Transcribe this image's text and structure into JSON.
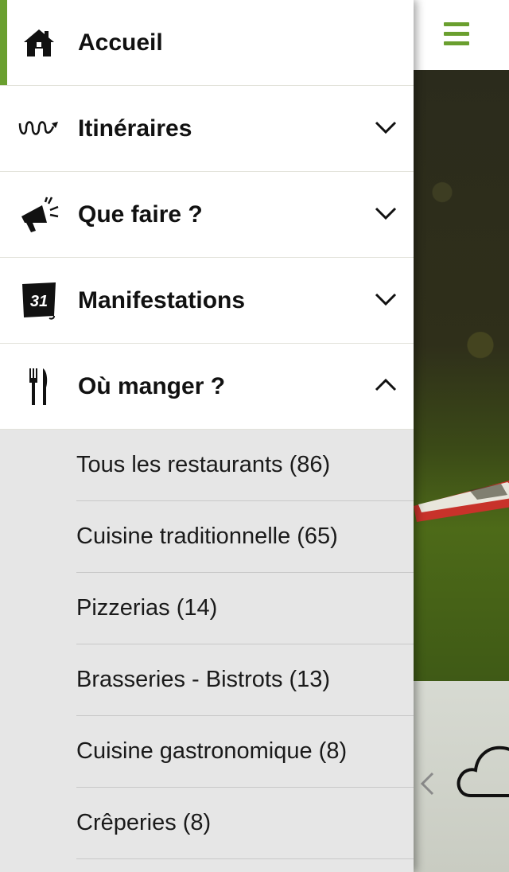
{
  "menu": {
    "items": [
      {
        "label": "Accueil",
        "icon": "home-icon",
        "active": true
      },
      {
        "label": "Itinéraires",
        "icon": "route-icon",
        "expanded": false
      },
      {
        "label": "Que faire ?",
        "icon": "megaphone-icon",
        "expanded": false
      },
      {
        "label": "Manifestations",
        "icon": "calendar-icon",
        "calendar_day": "31",
        "expanded": false
      },
      {
        "label": "Où manger ?",
        "icon": "fork-knife-icon",
        "expanded": true
      }
    ],
    "submenu": [
      {
        "label": "Tous les restaurants (86)"
      },
      {
        "label": "Cuisine traditionnelle (65)"
      },
      {
        "label": "Pizzerias (14)"
      },
      {
        "label": "Brasseries - Bistrots (13)"
      },
      {
        "label": "Cuisine gastronomique (8)"
      },
      {
        "label": "Crêperies (8)"
      }
    ]
  },
  "colors": {
    "accent": "#6a9f2f",
    "drawer_submenu_bg": "#e6e6e6",
    "text": "#111111"
  }
}
